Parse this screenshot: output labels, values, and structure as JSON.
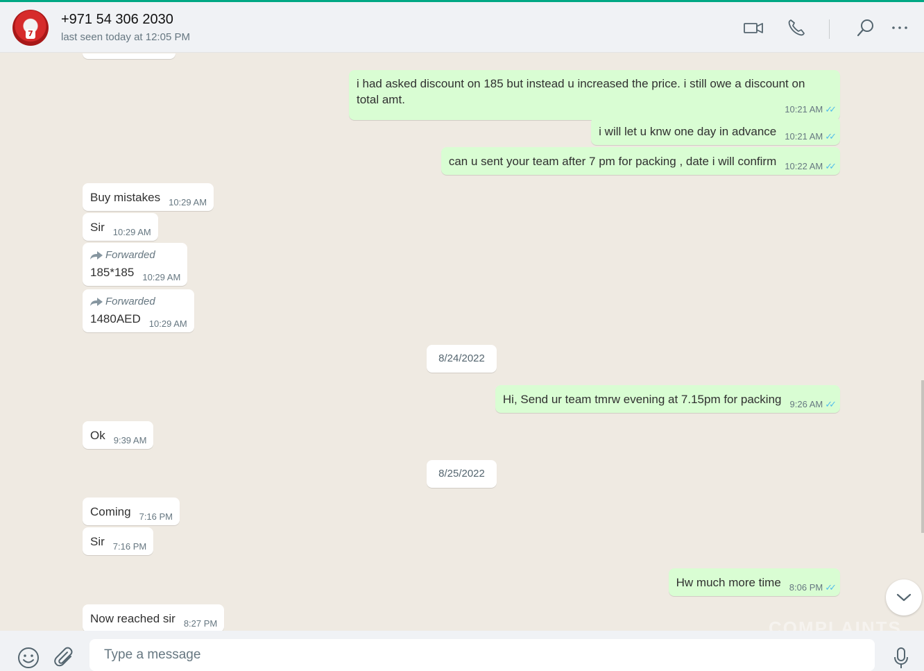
{
  "contact": {
    "name": "+971 54 306 2030",
    "status": "last seen today at 12:05 PM",
    "avatar_badge": "7"
  },
  "header_icons": [
    "video-call-icon",
    "voice-call-icon",
    "search-icon",
    "menu-icon"
  ],
  "messages": [
    {
      "dir": "out",
      "text_line1": "i had asked discount on 185 but instead u increased the price. i still owe a discount on",
      "text_line2": "total amt.",
      "time": "10:21 AM",
      "ticks": "✓✓"
    },
    {
      "dir": "out",
      "text": "i will let u knw one day in advance",
      "time": "10:21 AM",
      "ticks": "✓✓"
    },
    {
      "dir": "out",
      "text": "can u sent your team after 7 pm for packing , date i will confirm",
      "time": "10:22 AM",
      "ticks": "✓✓"
    },
    {
      "dir": "in",
      "text": "Buy mistakes",
      "time": "10:29 AM"
    },
    {
      "dir": "in",
      "text": "Sir",
      "time": "10:29 AM"
    },
    {
      "dir": "in",
      "forwarded": "Forwarded",
      "text": "185*185",
      "time": "10:29 AM"
    },
    {
      "dir": "in",
      "forwarded": "Forwarded",
      "text": "1480AED",
      "time": "10:29 AM"
    },
    {
      "dir": "out",
      "text": "Hi, Send ur team tmrw evening at 7.15pm for packing",
      "time": "9:26 AM",
      "ticks": "✓✓"
    },
    {
      "dir": "in",
      "text": "Ok",
      "time": "9:39 AM"
    },
    {
      "dir": "in",
      "text": "Coming",
      "time": "7:16 PM"
    },
    {
      "dir": "in",
      "text": "Sir",
      "time": "7:16 PM"
    },
    {
      "dir": "out",
      "text": "Hw much more time",
      "time": "8:06 PM",
      "ticks": "✓✓"
    },
    {
      "dir": "in",
      "text": "Now reached sir",
      "time": "8:27 PM"
    }
  ],
  "dates": [
    "8/24/2022",
    "8/25/2022"
  ],
  "composer": {
    "placeholder": "Type a message"
  },
  "watermark": "COMPLAINTS",
  "colors": {
    "accent": "#00a884",
    "outgoing_bubble": "#d9fdd3",
    "read_ticks": "#53bdeb",
    "chat_bg": "#efeae2"
  }
}
